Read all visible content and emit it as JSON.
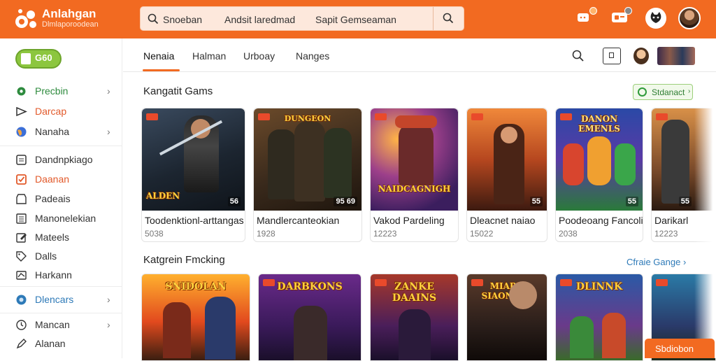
{
  "brand": {
    "title": "Anlahgan",
    "subtitle": "Dlmlaporoodean"
  },
  "search": {
    "segments": [
      "Snoeban",
      "Andsit laredmad",
      "Sapit Gemseaman"
    ]
  },
  "header": {
    "accent": "#f26a21",
    "icons": [
      "chat-icon",
      "message-icon",
      "cat-icon",
      "user-avatar"
    ]
  },
  "sidebar": {
    "logo_text": "G60",
    "items": [
      {
        "label": "Precbin",
        "icon": "gear-icon",
        "chevron": true,
        "color": "#2e8b3e"
      },
      {
        "label": "Darcap",
        "icon": "controller-icon",
        "chevron": false,
        "color": "#e2592a"
      },
      {
        "label": "Nanaha",
        "icon": "globe-icon",
        "chevron": true,
        "color": "#333333"
      },
      {
        "label": "Dandnpkiago",
        "icon": "document-icon",
        "chevron": false,
        "color": "#333333"
      },
      {
        "label": "Daanan",
        "icon": "checkbox-icon",
        "chevron": false,
        "color": "#e2592a"
      },
      {
        "label": "Padeais",
        "icon": "shop-icon",
        "chevron": false,
        "color": "#333333"
      },
      {
        "label": "Manonelekian",
        "icon": "list-icon",
        "chevron": false,
        "color": "#333333"
      },
      {
        "label": "Mateels",
        "icon": "edit-icon",
        "chevron": false,
        "color": "#333333"
      },
      {
        "label": "Dalls",
        "icon": "tag-icon",
        "chevron": false,
        "color": "#333333"
      },
      {
        "label": "Harkann",
        "icon": "flag-icon",
        "chevron": false,
        "color": "#333333"
      },
      {
        "label": "Dlencars",
        "icon": "circle-icon",
        "chevron": true,
        "color": "#2e7ab8"
      },
      {
        "label": "Mancan",
        "icon": "clock-icon",
        "chevron": true,
        "color": "#333333"
      },
      {
        "label": "Alanan",
        "icon": "pen-icon",
        "chevron": false,
        "color": "#333333"
      }
    ]
  },
  "tabs": [
    "Nenaia",
    "Halman",
    "Urboay",
    "Nanges"
  ],
  "sections": {
    "featured": {
      "title": "Kangatit Gams",
      "button_label": "Stdanact"
    },
    "ranking": {
      "title": "Katgrein Fmcking",
      "link_label": "Cfraie Gange"
    }
  },
  "cards": [
    {
      "title": "Toodenktionl-arttangas",
      "meta": "5038",
      "count": "56",
      "art_text": "ALDEN"
    },
    {
      "title": "Mandlercanteokian",
      "meta": "1928",
      "count": "95 69",
      "art_text": "DUNGEON"
    },
    {
      "title": "Vakod Pardeling",
      "meta": "12223",
      "count": "",
      "art_text": "NAIDCAGNIGH"
    },
    {
      "title": "Dleacnet naiao",
      "meta": "15022",
      "count": "55",
      "art_text": ""
    },
    {
      "title": "Poodeoang Fancolin",
      "meta": "2038",
      "count": "55",
      "art_text": "DANON EMENLS"
    },
    {
      "title": "Darikarl",
      "meta": "12223",
      "count": "55",
      "art_text": ""
    }
  ],
  "ranking_cards": [
    {
      "art_text": "SNIDOLAN"
    },
    {
      "art_text": "DARBKONS"
    },
    {
      "art_text": "ZANKE DAAINS"
    },
    {
      "art_text": "MIARK SIAONERS"
    },
    {
      "art_text": "DLINNK"
    },
    {
      "art_text": ""
    }
  ],
  "fab_label": "Sbdiobon"
}
